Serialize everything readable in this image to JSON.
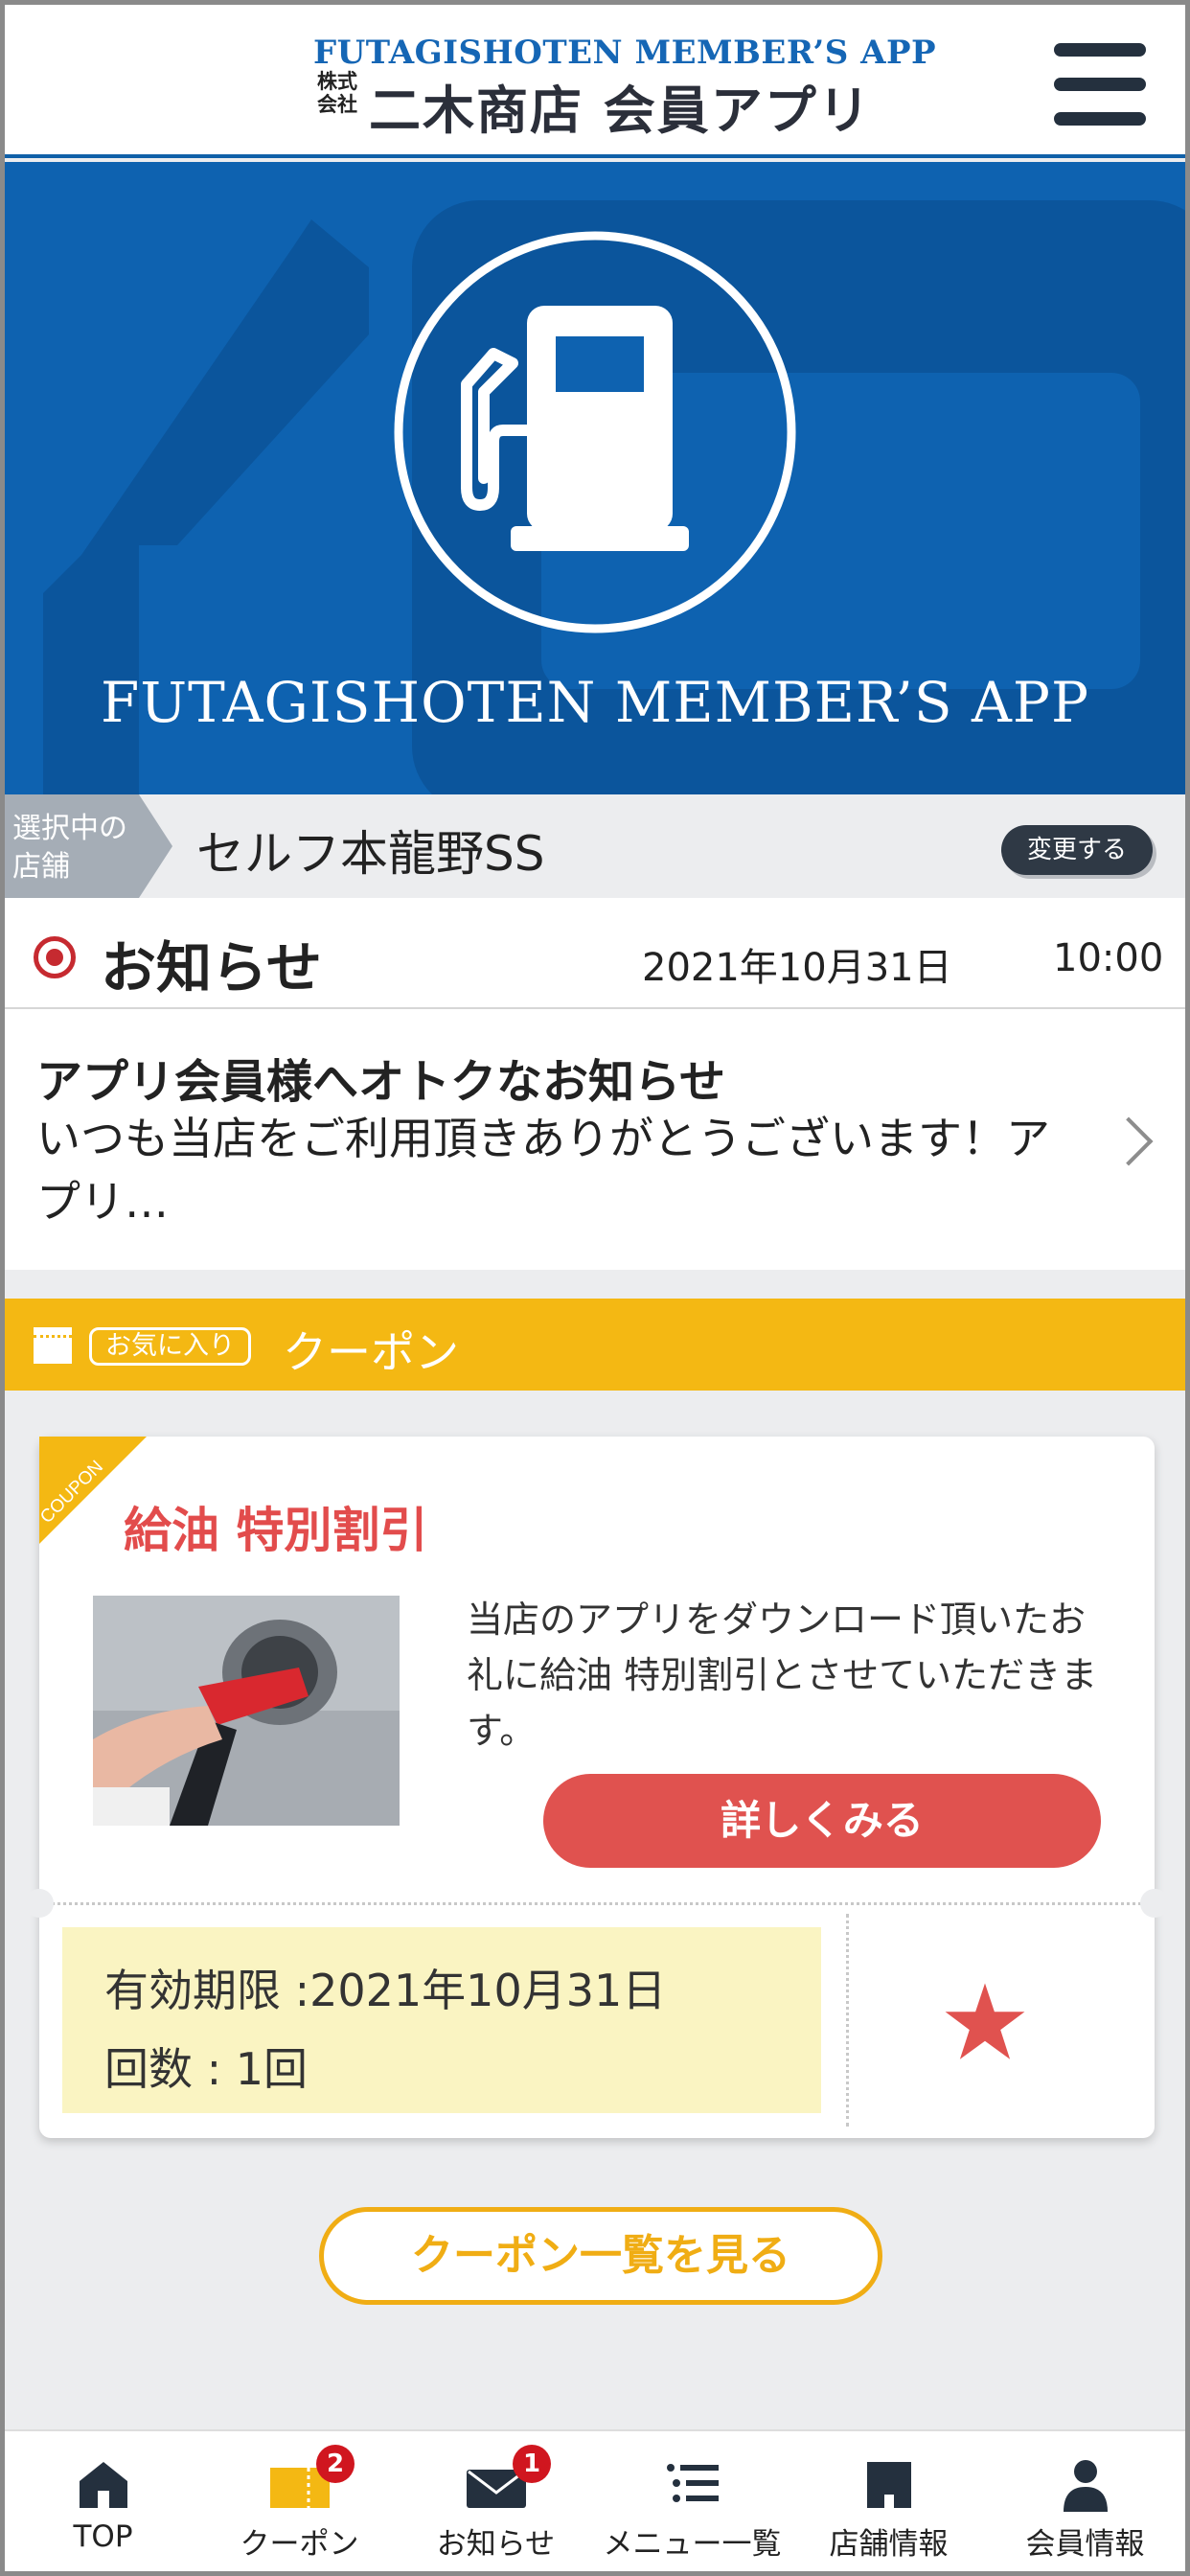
{
  "header": {
    "logo_en": "FUTAGISHOTEN MEMBER’S APP",
    "logo_kabushiki": "株式会社",
    "logo_jp": "二木商店 会員アプリ"
  },
  "hero": {
    "title": "FUTAGISHOTEN MEMBER’S APP"
  },
  "store": {
    "tag": "選択中の店舗",
    "name": "セルフ本龍野SS",
    "change_label": "変更する"
  },
  "news": {
    "section_title": "お知らせ",
    "date": "2021年10月31日",
    "time": "10:00",
    "item_title": "アプリ会員様へオトクなお知らせ",
    "item_text": "いつも当店をご利用頂きありがとうございます！アプリ…"
  },
  "coupon_section": {
    "favorite_tag": "お気に入り",
    "title": "クーポン"
  },
  "coupon": {
    "corner_label": "COUPON",
    "title": "給油 特別割引",
    "description": "当店のアプリをダウンロード頂いたお礼に給油 特別割引とさせていただきます。",
    "detail_button": "詳しくみる",
    "validity": "有効期限 :2021年10月31日",
    "count": "回数 : 1回"
  },
  "coupon_list_button": "クーポン一覧を見る",
  "bottom_nav": [
    {
      "label": "TOP",
      "icon": "home-icon"
    },
    {
      "label": "クーポン",
      "icon": "coupon-icon",
      "badge": "2"
    },
    {
      "label": "お知らせ",
      "icon": "mail-icon",
      "badge": "1"
    },
    {
      "label": "メニュー一覧",
      "icon": "menu-list-icon"
    },
    {
      "label": "店舗情報",
      "icon": "store-icon"
    },
    {
      "label": "会員情報",
      "icon": "person-icon"
    }
  ],
  "colors": {
    "brand_blue": "#0e62b0",
    "accent_yellow": "#f4b813",
    "coupon_red": "#e0524f",
    "badge_red": "#d0161f"
  }
}
